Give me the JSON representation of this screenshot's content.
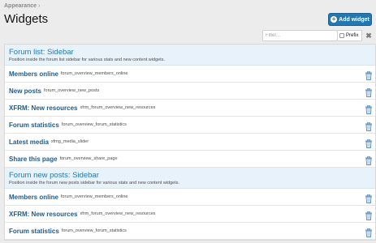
{
  "breadcrumb": {
    "item": "Appearance",
    "sep": "›"
  },
  "page_title": "Widgets",
  "add_button": {
    "label": "Add widget"
  },
  "filter": {
    "placeholder": "Filter...",
    "prefix_label": "Prefix",
    "clear": "✖"
  },
  "colors": {
    "accent": "#2577b1",
    "header_bg": "#e8f2fb",
    "link": "#1e5b8a",
    "trash": "#5b8fbf"
  },
  "groups": [
    {
      "title": "Forum list: Sidebar",
      "description": "Position inside the forum list sidebar for various stats and new content widgets.",
      "widgets": [
        {
          "name": "Members online",
          "key": "forum_overview_members_online"
        },
        {
          "name": "New posts",
          "key": "forum_overview_new_posts"
        },
        {
          "name": "XFRM: New resources",
          "key": "xfrm_forum_overview_new_resources"
        },
        {
          "name": "Forum statistics",
          "key": "forum_overview_forum_statistics"
        },
        {
          "name": "Latest media",
          "key": "xfmg_media_slider"
        },
        {
          "name": "Share this page",
          "key": "forum_overview_share_page"
        }
      ]
    },
    {
      "title": "Forum new posts: Sidebar",
      "description": "Position inside the forum new posts sidebar for various stats and new content widgets.",
      "widgets": [
        {
          "name": "Members online",
          "key": "forum_overview_members_online"
        },
        {
          "name": "XFRM: New resources",
          "key": "xfrm_forum_overview_new_resources"
        },
        {
          "name": "Forum statistics",
          "key": "forum_overview_forum_statistics"
        }
      ]
    }
  ]
}
